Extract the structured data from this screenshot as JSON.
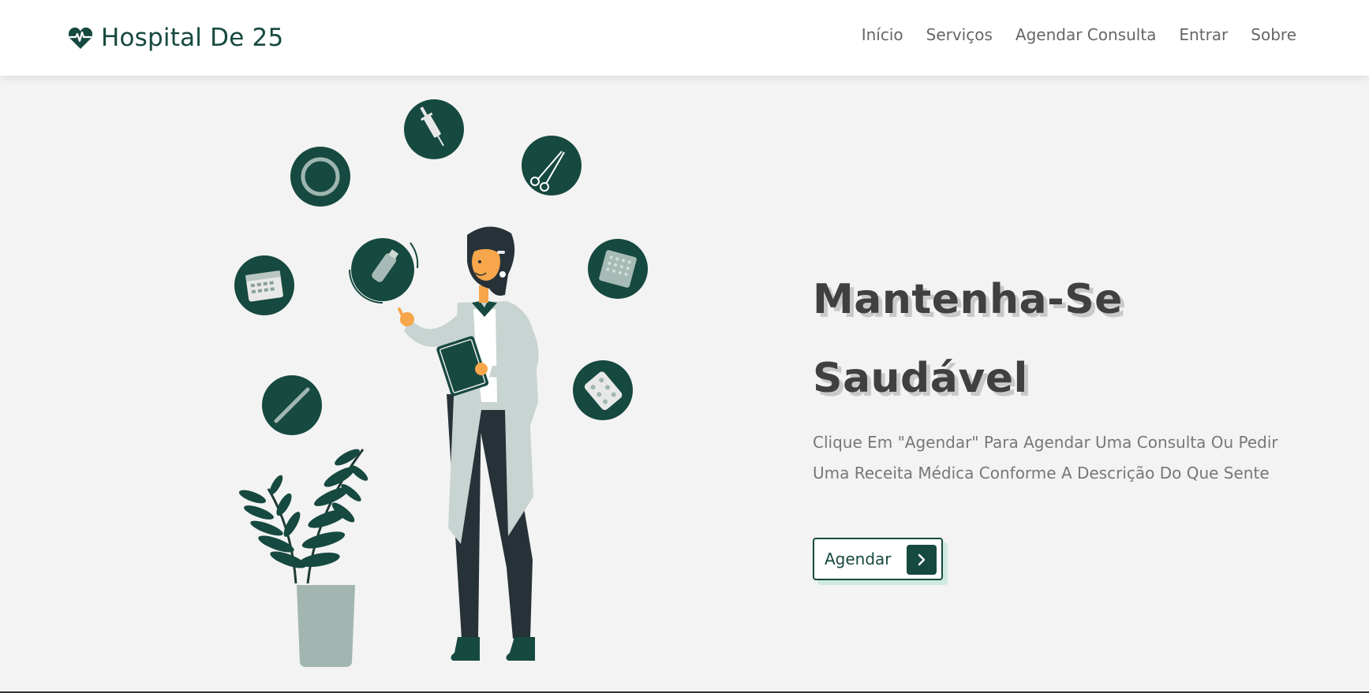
{
  "brand": {
    "name": "Hospital De 25",
    "icon": "heart-pulse-icon",
    "color": "#16493f"
  },
  "nav": {
    "items": [
      {
        "label": "Início"
      },
      {
        "label": "Serviços"
      },
      {
        "label": "Agendar Consulta"
      },
      {
        "label": "Entrar"
      },
      {
        "label": "Sobre"
      }
    ]
  },
  "hero": {
    "title_line1": "Mantenha-Se",
    "title_line2": "Saudável",
    "description": "Clique Em \"Agendar\" Para Agendar Uma Consulta Ou Pedir Uma Receita Médica Conforme A Descrição Do Que Sente",
    "cta_label": "Agendar",
    "cta_icon": "chevron-right-icon"
  },
  "illustration": {
    "subject": "doctor-illustration",
    "icons": [
      "syringe-icon",
      "scissors-icon",
      "ring-icon",
      "calendar-icon",
      "inhaler-icon",
      "bandage-icon",
      "pill-blister-icon",
      "tablet-pack-icon"
    ]
  },
  "colors": {
    "accent": "#16493f",
    "background": "#f3f3f3",
    "cta_shadow": "#cfeade"
  }
}
